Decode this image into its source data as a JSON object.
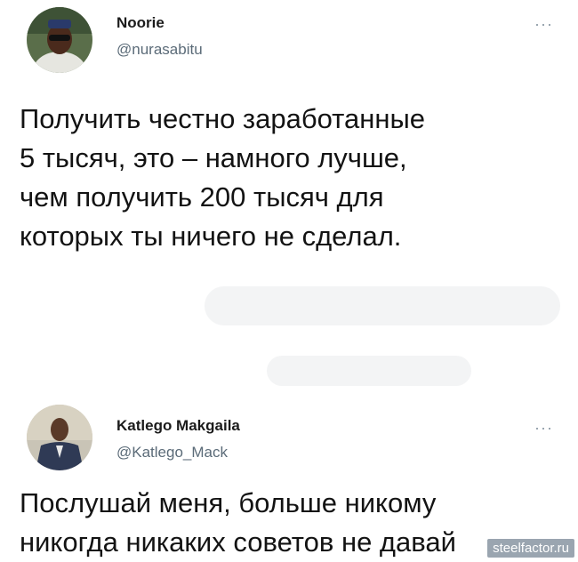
{
  "tweets": [
    {
      "name": "Noorie",
      "handle": "@nurasabitu",
      "more": "···",
      "text": "Получить честно заработанные\n5 тысяч, это – намного лучше,\nчем получить 200 тысяч для\nкоторых ты ничего не сделал."
    },
    {
      "name": "Katlego Makgaila",
      "handle": "@Katlego_Mack",
      "more": "···",
      "text": "Послушай меня, больше никому\nникогда никаких советов не давай"
    }
  ],
  "watermark": "steelfactor.ru",
  "colors": {
    "name": "#1b1b1b",
    "handle": "#5b6b78",
    "watermark_bg": "#9aa5b0"
  }
}
